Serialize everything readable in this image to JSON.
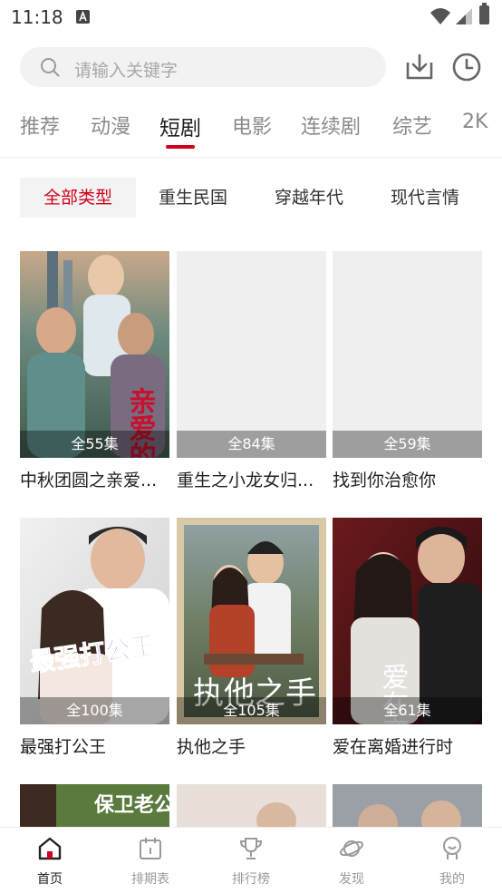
{
  "status": {
    "time": "11:18"
  },
  "search": {
    "placeholder": "请输入关键字"
  },
  "tabs": [
    "推荐",
    "动漫",
    "短剧",
    "电影",
    "连续剧",
    "综艺",
    "2K"
  ],
  "active_tab": "短剧",
  "chips": [
    "全部类型",
    "重生民国",
    "穿越年代",
    "现代言情"
  ],
  "active_chip": "全部类型",
  "items": [
    {
      "title": "中秋团圆之亲爱...",
      "episodes": "全55集"
    },
    {
      "title": "重生之小龙女归...",
      "episodes": "全84集"
    },
    {
      "title": "找到你治愈你",
      "episodes": "全59集"
    },
    {
      "title": "最强打公王",
      "episodes": "全100集"
    },
    {
      "title": "执他之手",
      "episodes": "全105集"
    },
    {
      "title": "爱在离婚进行时",
      "episodes": "全61集"
    }
  ],
  "poster_text": {
    "p1": "亲爱的你",
    "p4": "最强打公王",
    "p5": "执他之手",
    "p6": "爱在离婚",
    "p7": "保卫老公"
  },
  "bottom_nav": [
    "首页",
    "排期表",
    "排行榜",
    "发现",
    "我的"
  ],
  "colors": {
    "accent": "#d0021b"
  }
}
